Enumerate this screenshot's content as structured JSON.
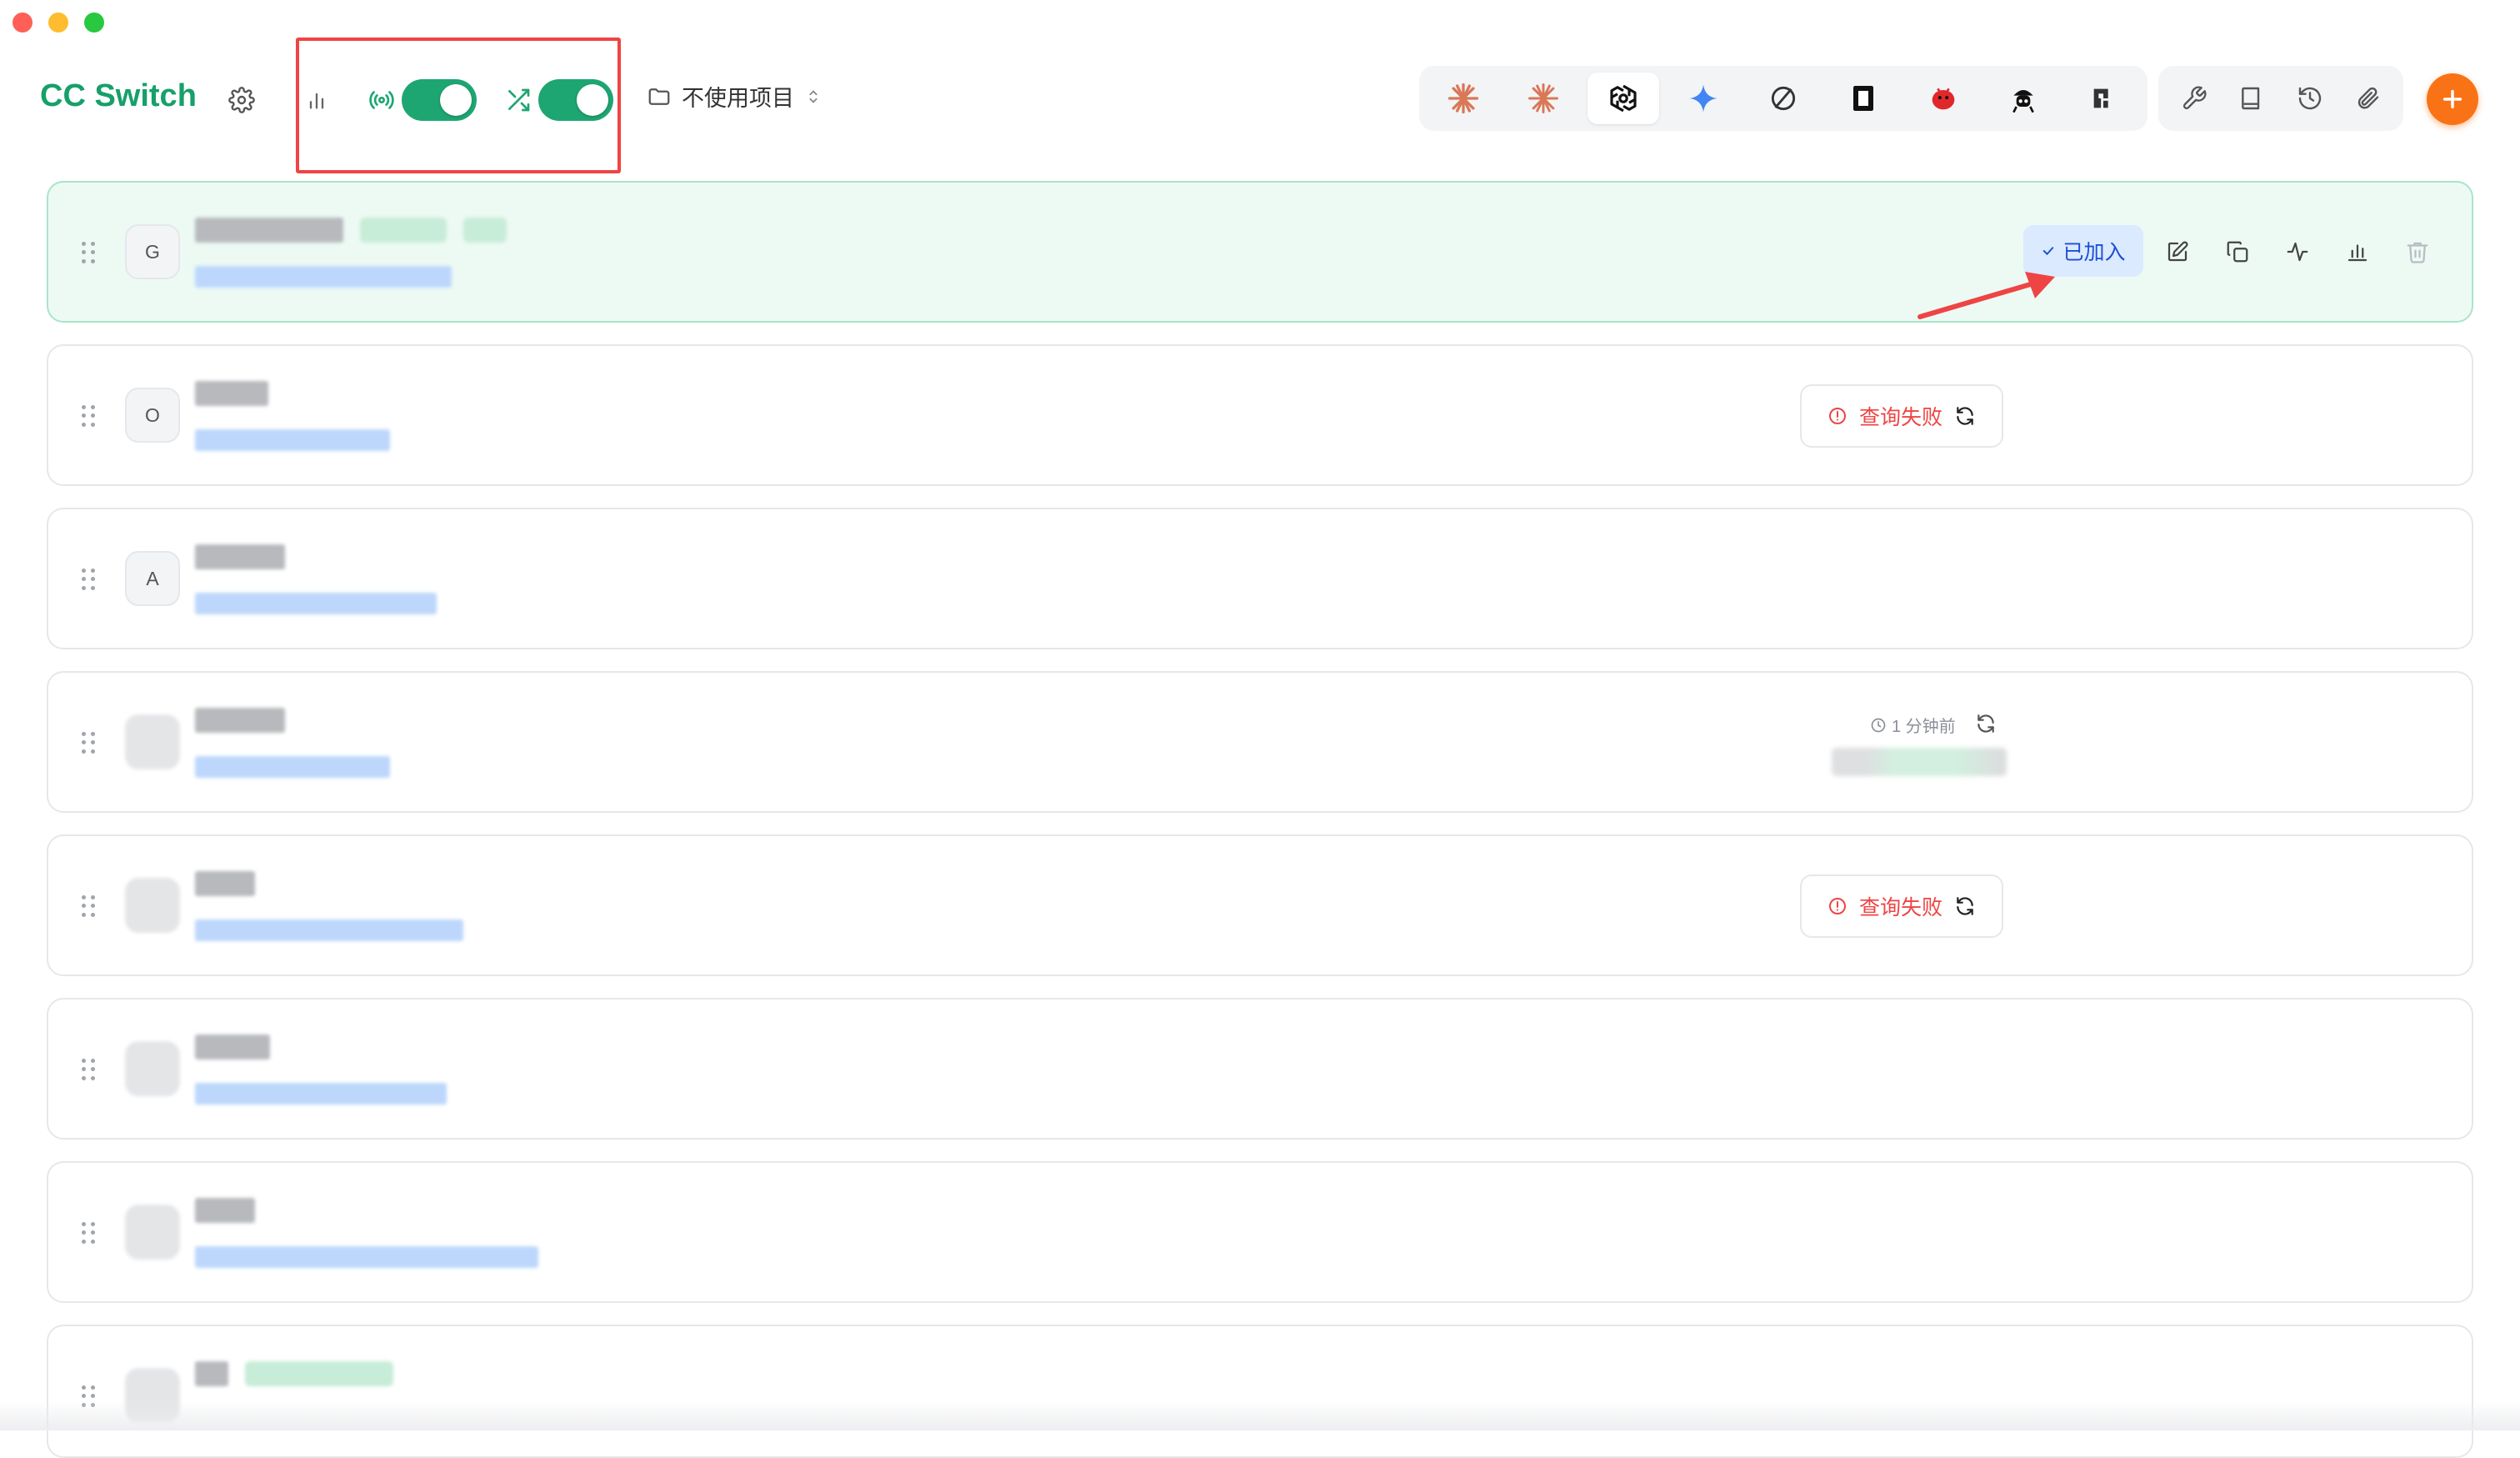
{
  "window": {
    "controls": [
      "close",
      "minimize",
      "maximize"
    ]
  },
  "header": {
    "title": "CC Switch",
    "settings_icon": "gear-icon",
    "stats_icon": "bar-chart-icon",
    "proxy_icon": "broadcast-icon",
    "proxy_enabled": true,
    "failover_icon": "shuffle-icon",
    "failover_enabled": true,
    "project_icon": "folder-icon",
    "project_label": "不使用项目",
    "project_chevron": "chevron-updown-icon"
  },
  "app_switcher": {
    "apps": [
      {
        "icon": "claude-code-icon",
        "color": "#d97757",
        "active": false
      },
      {
        "icon": "claude-desktop-icon",
        "color": "#d97757",
        "active": false
      },
      {
        "icon": "openai-codex-icon",
        "color": "#111111",
        "active": true
      },
      {
        "icon": "gemini-icon",
        "color": "#4285f4",
        "active": false
      },
      {
        "icon": "opencode-icon",
        "color": "#333333",
        "active": false
      },
      {
        "icon": "terminal-app-icon",
        "color": "#111111",
        "active": false
      },
      {
        "icon": "red-blob-icon",
        "color": "#e0282b",
        "active": false
      },
      {
        "icon": "hat-character-icon",
        "color": "#111111",
        "active": false
      },
      {
        "icon": "pixel-app-icon",
        "color": "#333333",
        "active": false
      }
    ]
  },
  "tools": [
    {
      "icon": "wrench-icon"
    },
    {
      "icon": "book-icon"
    },
    {
      "icon": "history-icon"
    },
    {
      "icon": "paperclip-icon"
    }
  ],
  "add_button_icon": "plus-icon",
  "providers": [
    {
      "avatar": "G",
      "active": true,
      "status": "joined",
      "joined_label": "已加入"
    },
    {
      "avatar": "O",
      "active": false,
      "status": "failed",
      "fail_label": "查询失败"
    },
    {
      "avatar": "A",
      "active": false,
      "status": "none"
    },
    {
      "avatar": "",
      "active": false,
      "status": "time",
      "time_label": "1 分钟前"
    },
    {
      "avatar": "",
      "active": false,
      "status": "failed",
      "fail_label": "查询失败"
    },
    {
      "avatar": "",
      "active": false,
      "status": "none"
    },
    {
      "avatar": "",
      "active": false,
      "status": "none"
    },
    {
      "avatar": "",
      "active": false,
      "status": "none"
    }
  ],
  "colors": {
    "brand": "#16a06a",
    "toggle_on": "#1ea672",
    "add": "#f97316",
    "joined_bg": "#dbeafe",
    "joined_text": "#1d4ed8",
    "error": "#ef4444",
    "annotation": "#ef4444"
  }
}
